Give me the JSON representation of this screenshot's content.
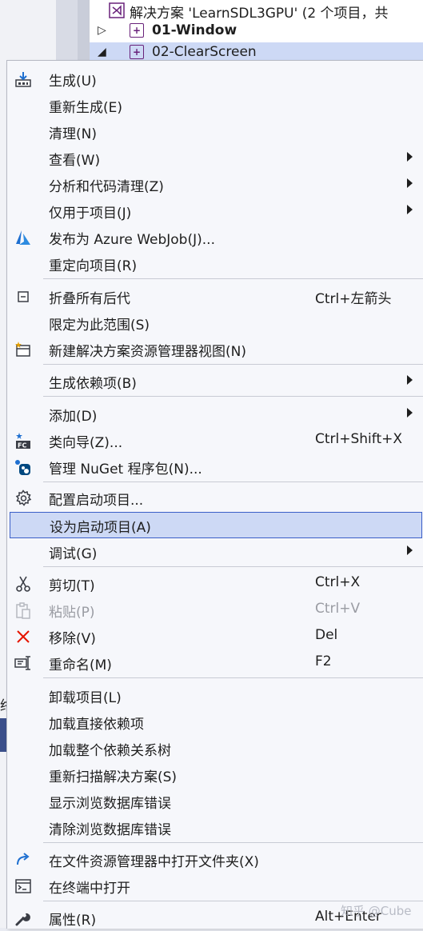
{
  "explorer": {
    "solution_label": "解决方案 'LearnSDL3GPU' (2 个项目，共",
    "project1": "01-Window",
    "project2": "02-ClearScreen"
  },
  "left_fragment": "络",
  "menu": {
    "build": "生成(U)",
    "rebuild": "重新生成(E)",
    "clean": "清理(N)",
    "view": "查看(W)",
    "analyze": "分析和代码清理(Z)",
    "project_only": "仅用于项目(J)",
    "publish_azure": "发布为 Azure WebJob(J)...",
    "retarget": "重定向项目(R)",
    "collapse_all": "折叠所有后代",
    "collapse_all_sc": "Ctrl+左箭头",
    "scope_to_this": "限定为此范围(S)",
    "new_explorer_view": "新建解决方案资源管理器视图(N)",
    "build_deps": "生成依赖项(B)",
    "add": "添加(D)",
    "class_wizard": "类向导(Z)...",
    "class_wizard_sc": "Ctrl+Shift+X",
    "manage_nuget": "管理 NuGet 程序包(N)...",
    "configure_startup": "配置启动项目...",
    "set_startup": "设为启动项目(A)",
    "debug": "调试(G)",
    "cut": "剪切(T)",
    "cut_sc": "Ctrl+X",
    "paste": "粘贴(P)",
    "paste_sc": "Ctrl+V",
    "remove": "移除(V)",
    "remove_sc": "Del",
    "rename": "重命名(M)",
    "rename_sc": "F2",
    "unload": "卸载项目(L)",
    "load_direct_deps": "加载直接依赖项",
    "load_dep_tree": "加载整个依赖关系树",
    "rescan": "重新扫描解决方案(S)",
    "show_db_errors": "显示浏览数据库错误",
    "clear_db_errors": "清除浏览数据库错误",
    "open_in_explorer": "在文件资源管理器中打开文件夹(X)",
    "open_in_terminal": "在终端中打开",
    "properties": "属性(R)",
    "properties_sc": "Alt+Enter"
  },
  "watermark": "知乎 @Cube",
  "colors": {
    "highlight_bg": "#cdd9f5",
    "highlight_border": "#3a5fc8",
    "vs_purple": "#68217a",
    "remove_red": "#e51400",
    "icon_blue": "#1e6fd0"
  }
}
